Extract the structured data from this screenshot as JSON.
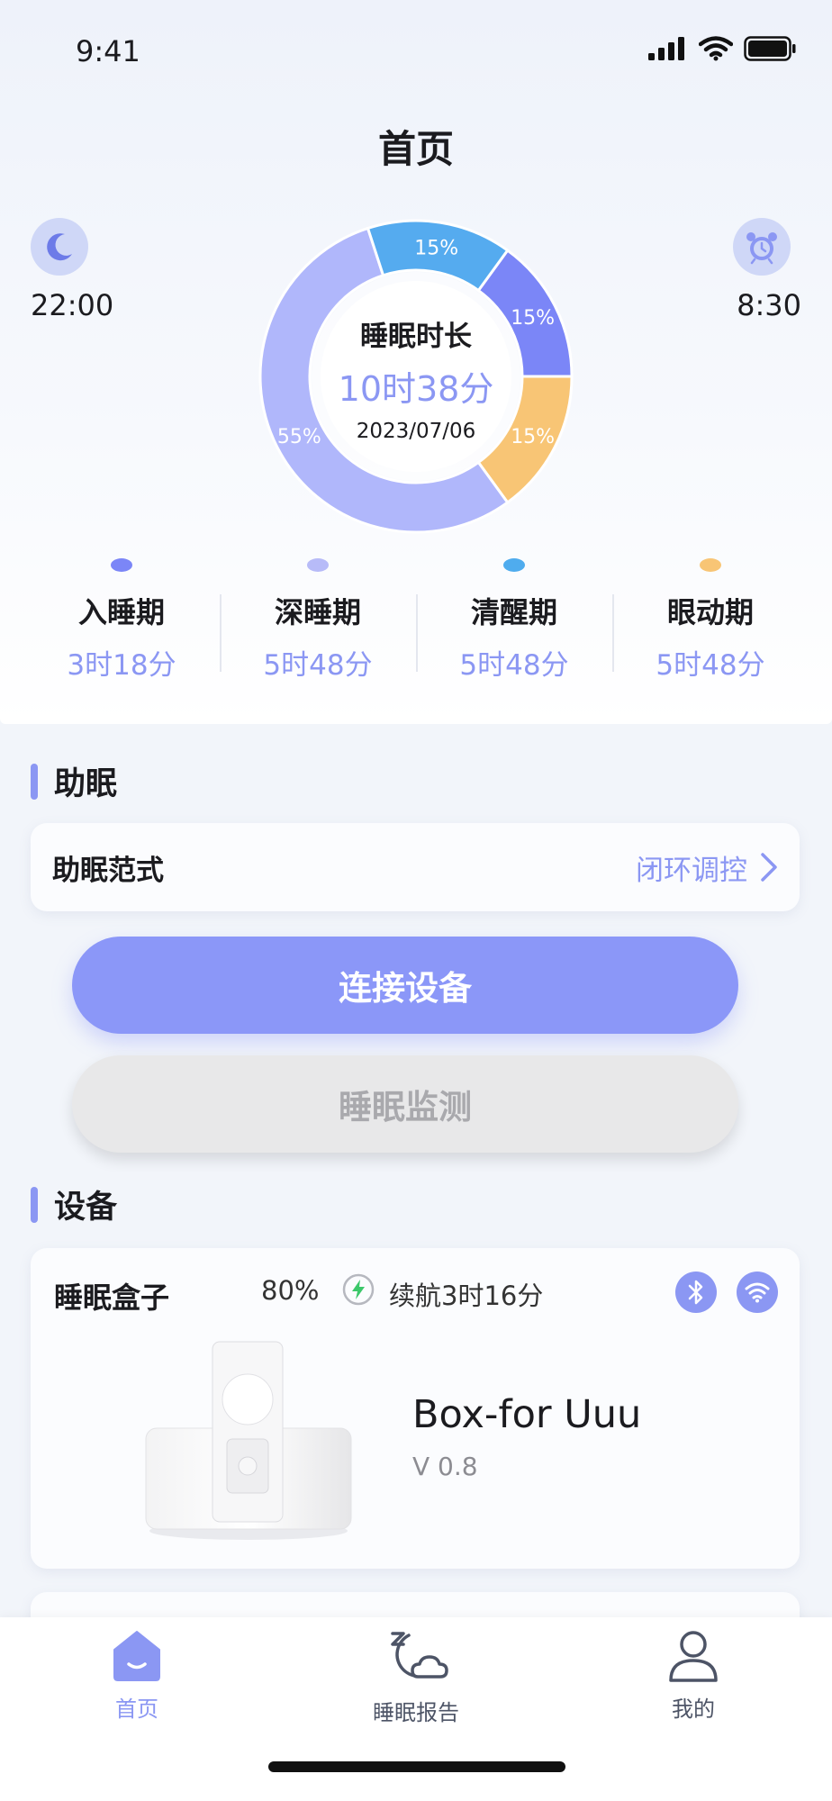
{
  "status_bar": {
    "time": "9:41"
  },
  "header": {
    "title": "首页"
  },
  "sleep_summary": {
    "bedtime": "22:00",
    "wake_time": "8:30",
    "center_label": "睡眠时长",
    "duration": "10时38分",
    "date": "2023/07/06",
    "segments": [
      {
        "label": "15%",
        "value": 15,
        "color": "#7b86f7"
      },
      {
        "label": "15%",
        "value": 15,
        "color": "#f8c575"
      },
      {
        "label": "55%",
        "value": 55,
        "color": "#b0b7fb"
      },
      {
        "label": "15%",
        "value": 15,
        "color": "#55abef"
      }
    ]
  },
  "stages": [
    {
      "name": "入睡期",
      "duration": "3时18分",
      "color": "#7b86f7"
    },
    {
      "name": "深睡期",
      "duration": "5时48分",
      "color": "#b7bbf8"
    },
    {
      "name": "清醒期",
      "duration": "5时48分",
      "color": "#4facee"
    },
    {
      "name": "眼动期",
      "duration": "5时48分",
      "color": "#f8c575"
    }
  ],
  "sleep_aid": {
    "section_title": "助眠",
    "mode_label": "助眠范式",
    "mode_value": "闭环调控",
    "connect_button": "连接设备",
    "monitor_button": "睡眠监测"
  },
  "devices": {
    "section_title": "设备",
    "item": {
      "name": "睡眠盒子",
      "battery": "80%",
      "range": "续航3时16分",
      "model": "Box-for Uuu",
      "version": "V 0.8"
    }
  },
  "tabbar": {
    "items": [
      {
        "label": "首页",
        "icon": "home-icon",
        "active": true
      },
      {
        "label": "睡眠报告",
        "icon": "sleep-report-icon",
        "active": false
      },
      {
        "label": "我的",
        "icon": "profile-icon",
        "active": false
      }
    ]
  },
  "colors": {
    "accent": "#8b97f3",
    "inactive": "#4d5466"
  }
}
